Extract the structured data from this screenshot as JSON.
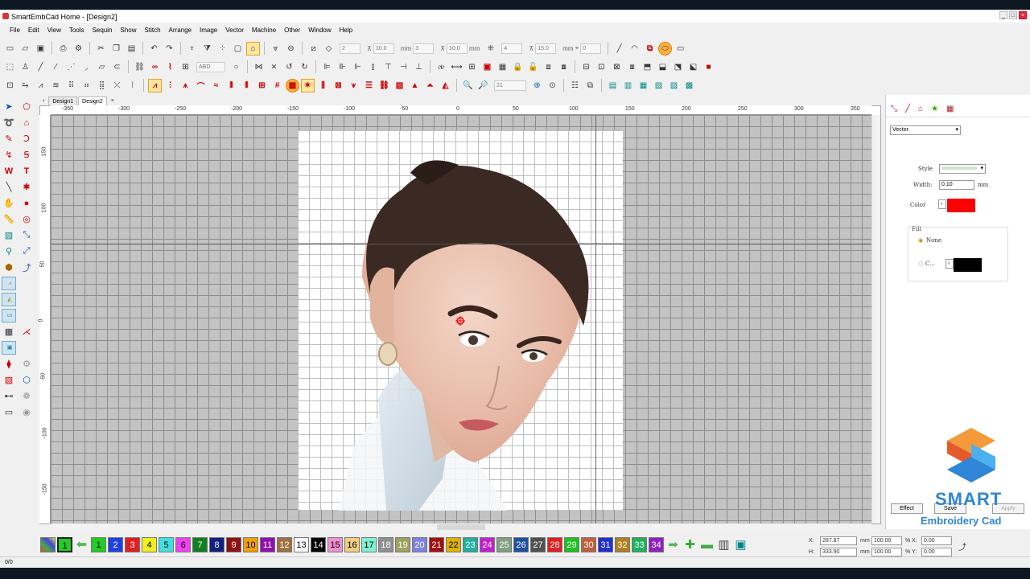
{
  "window": {
    "title": "SmartEmbCad Home - [Design2]"
  },
  "menu": [
    "File",
    "Edit",
    "View",
    "Tools",
    "Sequin",
    "Stitch",
    "Show",
    "Stitch",
    "Arrange",
    "Image",
    "Vector",
    "Machine",
    "Other",
    "Window",
    "Help"
  ],
  "toolbar1": {
    "fields": [
      {
        "label": "",
        "value": "2"
      },
      {
        "label": "",
        "value": "10.0"
      },
      {
        "label": "mm",
        "value": "3"
      },
      {
        "label": "",
        "value": "10.0"
      },
      {
        "label": "mm",
        "value": ""
      },
      {
        "label": "",
        "value": "4"
      },
      {
        "label": "",
        "value": "15.0"
      },
      {
        "label": "mm",
        "value": "0"
      }
    ]
  },
  "toolbar2": {
    "font_preview": "ABD"
  },
  "toolbar3": {
    "zoom_value": "21"
  },
  "tabs": [
    {
      "label": "Design1",
      "active": false
    },
    {
      "label": "Design2",
      "active": true
    }
  ],
  "ruler": {
    "h_labels": [
      "-350",
      "-300",
      "-250",
      "-200",
      "-150",
      "-100",
      "-50",
      "0",
      "50",
      "100",
      "150",
      "200",
      "250",
      "300",
      "350"
    ],
    "v_labels": [
      "150",
      "100",
      "50",
      "0",
      "-50",
      "-100",
      "-150"
    ]
  },
  "properties": {
    "mode": "Vector",
    "style_label": "Style",
    "width_label": "Width:",
    "width_value": "0.10",
    "width_unit": "mm",
    "color_label": "Color",
    "color_value": "#ff0000",
    "fill_label": "Fill",
    "fill_none_label": "None",
    "fill_color_label": "C...",
    "fill_color_value": "#000000",
    "effect_label": "Effect",
    "save_label": "Save",
    "apply_label": "Apply"
  },
  "logo": {
    "line1": "SMART",
    "line2": "Embroidery Cad"
  },
  "palette": [
    {
      "n": "1",
      "c": "#22aa22"
    },
    {
      "n": "1",
      "c": "#22cc22"
    },
    {
      "n": "2",
      "c": "#2040e0"
    },
    {
      "n": "3",
      "c": "#e02020"
    },
    {
      "n": "4",
      "c": "#f0f020"
    },
    {
      "n": "5",
      "c": "#40e0e0"
    },
    {
      "n": "6",
      "c": "#f040f0"
    },
    {
      "n": "7",
      "c": "#108020"
    },
    {
      "n": "8",
      "c": "#102080"
    },
    {
      "n": "9",
      "c": "#901010"
    },
    {
      "n": "10",
      "c": "#f0a000"
    },
    {
      "n": "11",
      "c": "#9010b0"
    },
    {
      "n": "12",
      "c": "#a07040"
    },
    {
      "n": "13",
      "c": "#ffffff"
    },
    {
      "n": "14",
      "c": "#000000"
    },
    {
      "n": "15",
      "c": "#f090d0"
    },
    {
      "n": "16",
      "c": "#f0d080"
    },
    {
      "n": "17",
      "c": "#80f0d0"
    },
    {
      "n": "18",
      "c": "#909090"
    },
    {
      "n": "19",
      "c": "#a0a060"
    },
    {
      "n": "20",
      "c": "#8080e0"
    },
    {
      "n": "21",
      "c": "#a01010"
    },
    {
      "n": "22",
      "c": "#e0b000"
    },
    {
      "n": "23",
      "c": "#20b0a0"
    },
    {
      "n": "24",
      "c": "#c020d0"
    },
    {
      "n": "25",
      "c": "#80a080"
    },
    {
      "n": "26",
      "c": "#2050a0"
    },
    {
      "n": "27",
      "c": "#505050"
    },
    {
      "n": "28",
      "c": "#e02020"
    },
    {
      "n": "29",
      "c": "#20c020"
    },
    {
      "n": "30",
      "c": "#c06040"
    },
    {
      "n": "31",
      "c": "#2030d0"
    },
    {
      "n": "32",
      "c": "#b08020"
    },
    {
      "n": "33",
      "c": "#20b060"
    },
    {
      "n": "34",
      "c": "#9020c0"
    }
  ],
  "coords": {
    "x_label": "X:",
    "x_value": "287.87",
    "y_label": "H:",
    "y_value": "333.90",
    "unit": "mm",
    "sx_value": "100.00",
    "sy_value": "100.00",
    "pct": "%",
    "rx_value": "0.00",
    "ry_value": "0.00"
  },
  "status": {
    "text": "0/0"
  }
}
